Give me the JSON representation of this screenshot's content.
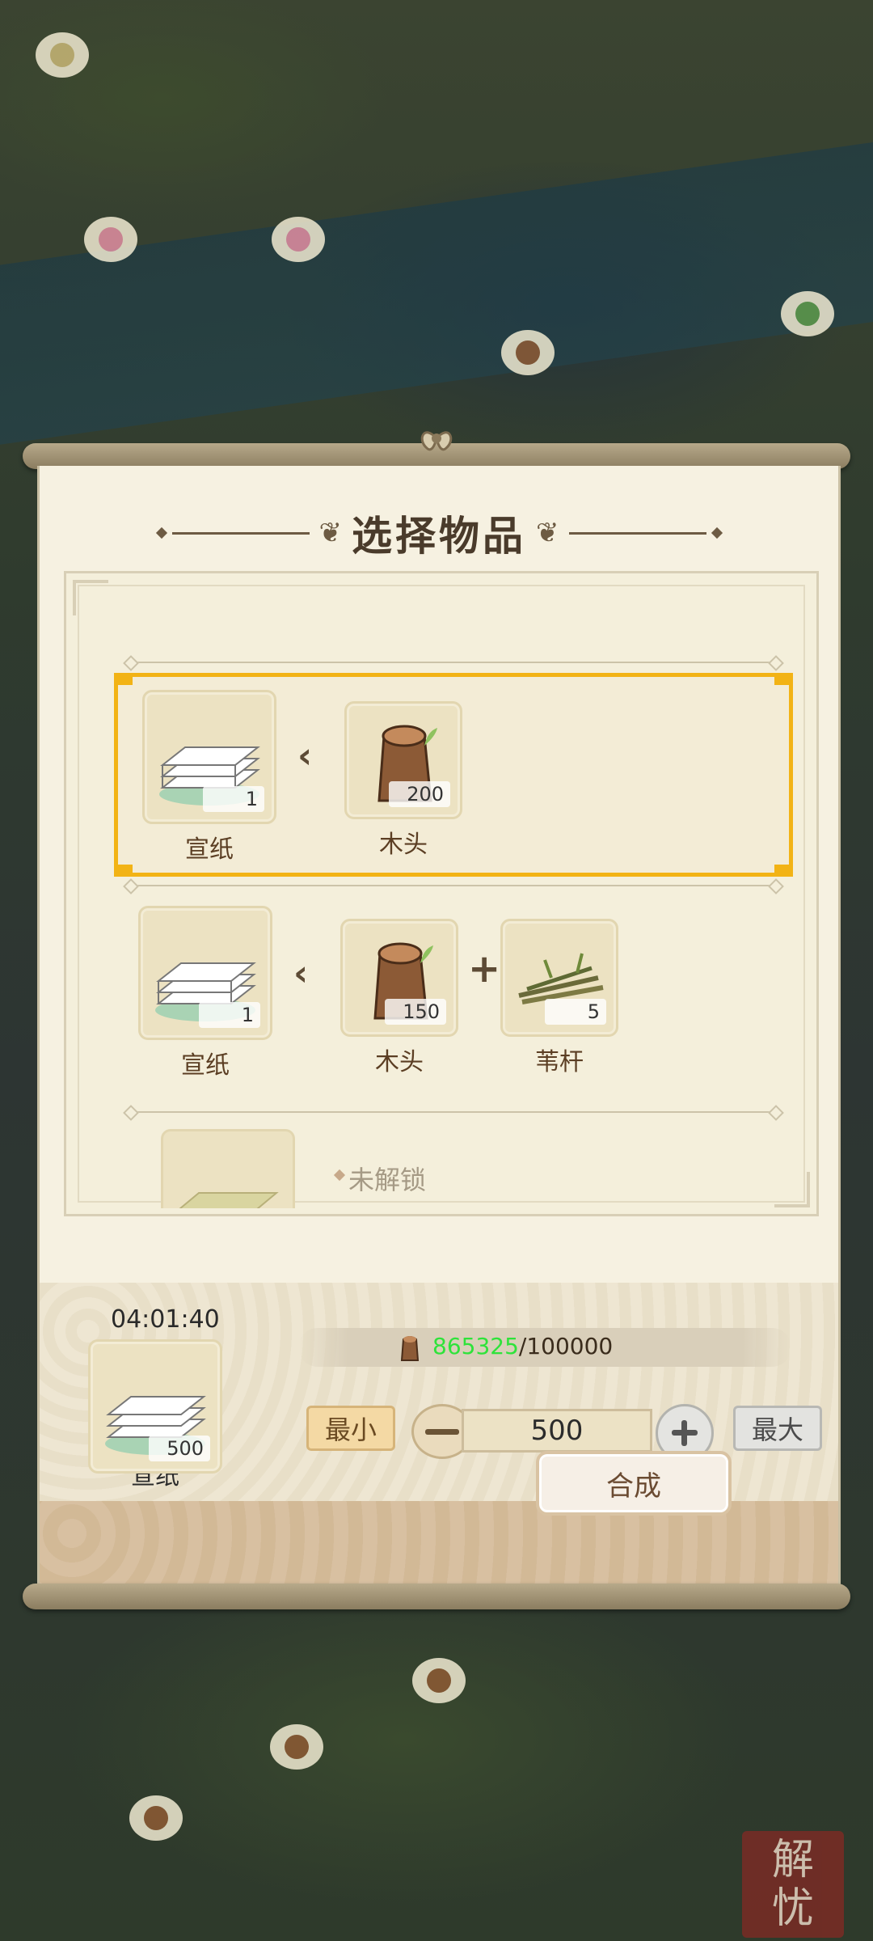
{
  "dialog": {
    "title": "选择物品",
    "recipes": [
      {
        "selected": true,
        "output": {
          "name": "宣纸",
          "count": "1",
          "icon": "paper-stack-icon"
        },
        "inputs": [
          {
            "name": "木头",
            "count": "200",
            "icon": "wood-log-icon"
          }
        ]
      },
      {
        "selected": false,
        "output": {
          "name": "宣纸",
          "count": "1",
          "icon": "paper-stack-icon"
        },
        "inputs": [
          {
            "name": "木头",
            "count": "150",
            "icon": "wood-log-icon"
          },
          {
            "name": "苇杆",
            "count": "5",
            "icon": "reed-stalks-icon"
          }
        ]
      }
    ],
    "locked_label": "未解锁"
  },
  "crafting": {
    "timer": "04:01:40",
    "resource_current": "865325",
    "resource_max": "/100000",
    "resource_icon": "wood-log-icon",
    "output_name": "宣纸",
    "output_count": "500",
    "min_label": "最小",
    "max_label": "最大",
    "quantity": "500",
    "craft_label": "合成"
  },
  "seal_text": "解忧",
  "colors": {
    "selection": "#f2b315",
    "resource_current": "#2ee33a",
    "paper": "#f6f1e1"
  }
}
